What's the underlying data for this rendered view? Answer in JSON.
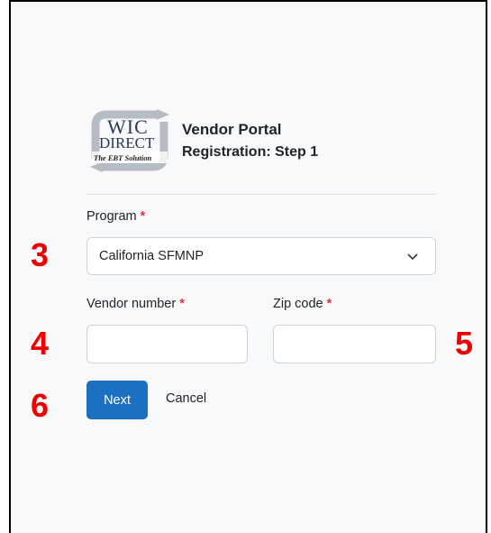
{
  "header": {
    "title": "Vendor Portal",
    "subtitle": "Registration: Step 1",
    "logo": {
      "line1": "WIC",
      "line2": "DIRECT",
      "tagline": "The EBT Solution"
    }
  },
  "form": {
    "program": {
      "label": "Program",
      "required_mark": "*",
      "selected_value": "California SFMNP"
    },
    "vendor_number": {
      "label": "Vendor number",
      "required_mark": "*",
      "value": ""
    },
    "zip_code": {
      "label": "Zip code",
      "required_mark": "*",
      "value": ""
    },
    "next_label": "Next",
    "cancel_label": "Cancel"
  },
  "annotations": {
    "program_marker": "3",
    "vendor_marker": "4",
    "zip_marker": "5",
    "next_marker": "6",
    "color": "#ee0000"
  },
  "colors": {
    "primary_button": "#1c6fc1",
    "required": "#dc3545",
    "background": "#f8f9fb"
  }
}
